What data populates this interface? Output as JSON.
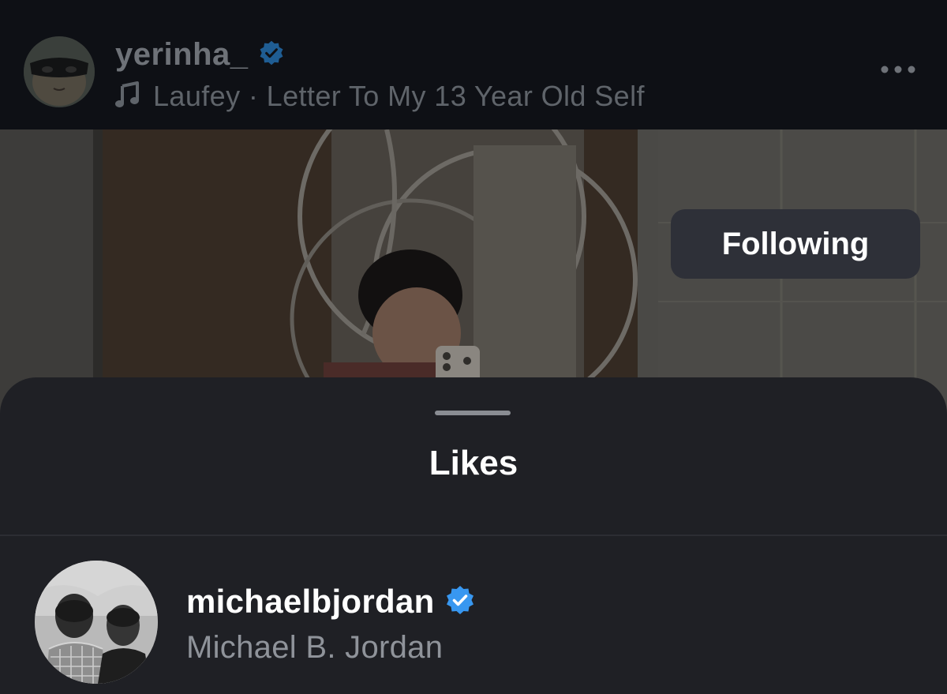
{
  "post": {
    "username": "yerinha_",
    "audio": "Laufey · Letter To My 13 Year Old Self",
    "more_icon": "more-horizontal-icon",
    "audio_icon": "music-note-icon"
  },
  "likes_sheet": {
    "title": "Likes",
    "items": [
      {
        "username": "michaelbjordan",
        "full_name": "Michael B. Jordan",
        "verified": true,
        "follow_label": "Following"
      }
    ]
  },
  "colors": {
    "verified_badge": "#3897f0",
    "sheet_background": "#1f2025",
    "following_button": "#2e3038"
  }
}
